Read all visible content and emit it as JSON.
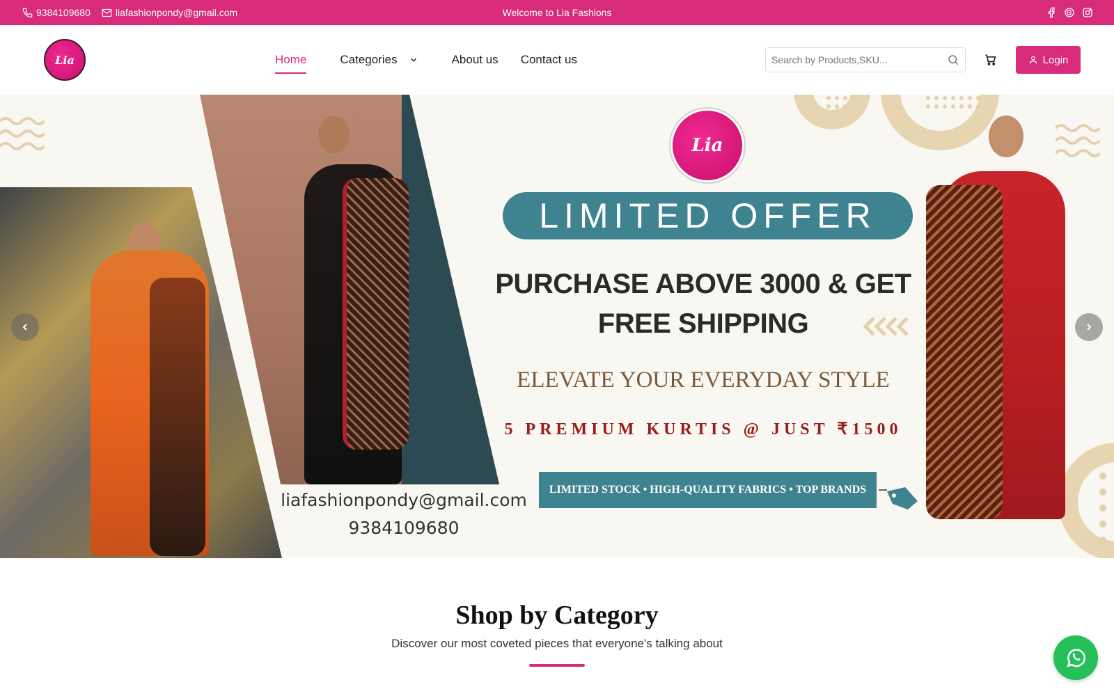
{
  "topbar": {
    "phone": "9384109680",
    "email": "liafashionpondy@gmail.com",
    "welcome": "Welcome to Lia Fashions"
  },
  "header": {
    "logo_text": "Lia",
    "nav": {
      "home": "Home",
      "categories": "Categories",
      "about": "About us",
      "contact": "Contact us"
    },
    "search_placeholder": "Search by Products,SKU...",
    "login_label": "Login"
  },
  "banner": {
    "logo_text": "Lia",
    "offer": "LIMITED OFFER",
    "headline_line1": "PURCHASE ABOVE 3000 & GET",
    "headline_line2": "FREE SHIPPING",
    "tagline": "ELEVATE YOUR EVERYDAY STYLE",
    "premium": "5 PREMIUM KURTIS @ JUST ₹1500",
    "stock": "LIMITED STOCK • HIGH-QUALITY FABRICS • TOP BRANDS",
    "email": "liafashionpondy@gmail.com",
    "phone": "9384109680"
  },
  "section": {
    "title": "Shop by Category",
    "subtitle": "Discover our most coveted pieces that everyone's talking about"
  },
  "colors": {
    "brand": "#d82c7a",
    "teal": "#3f8391",
    "whatsapp": "#25c05a"
  },
  "icons": [
    "phone-icon",
    "mail-icon",
    "facebook-icon",
    "threads-icon",
    "instagram-icon",
    "chevron-down-icon",
    "search-icon",
    "cart-icon",
    "user-icon",
    "chevron-left-icon",
    "chevron-right-icon",
    "whatsapp-icon"
  ]
}
